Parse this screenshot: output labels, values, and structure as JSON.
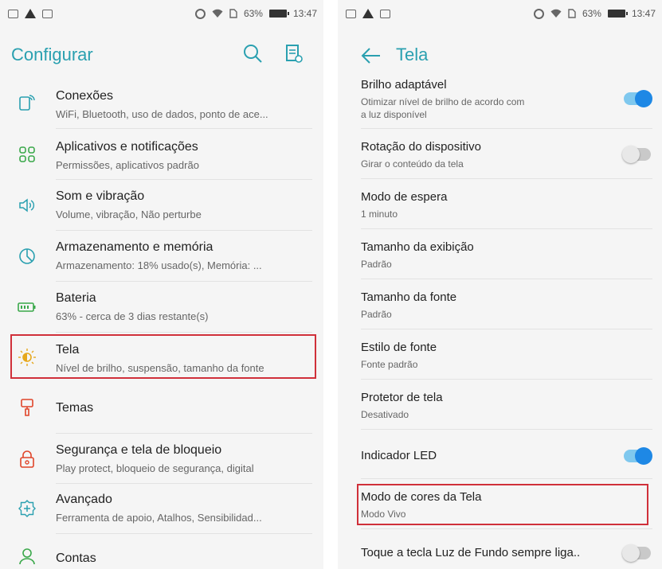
{
  "status_bar": {
    "battery": "63%",
    "time": "13:47"
  },
  "settings": {
    "title": "Configurar",
    "items": [
      {
        "icon": "connections-icon",
        "title": "Conexões",
        "subtitle": "WiFi, Bluetooth, uso de dados, ponto de ace..."
      },
      {
        "icon": "apps-icon",
        "title": "Aplicativos e notificações",
        "subtitle": "Permissões, aplicativos padrão"
      },
      {
        "icon": "volume-icon",
        "title": "Som e vibração",
        "subtitle": "Volume, vibração, Não perturbe"
      },
      {
        "icon": "storage-icon",
        "title": "Armazenamento e memória",
        "subtitle": "Armazenamento: 18% usado(s), Memória: ..."
      },
      {
        "icon": "battery-icon",
        "title": "Bateria",
        "subtitle": "63% - cerca de 3 dias restante(s)"
      },
      {
        "icon": "display-icon",
        "title": "Tela",
        "subtitle": "Nível de brilho, suspensão, tamanho da fonte"
      },
      {
        "icon": "themes-icon",
        "title": "Temas",
        "subtitle": ""
      },
      {
        "icon": "lock-icon",
        "title": "Segurança e tela de bloqueio",
        "subtitle": "Play protect, bloqueio de segurança, digital"
      },
      {
        "icon": "advanced-icon",
        "title": "Avançado",
        "subtitle": "Ferramenta de apoio, Atalhos, Sensibilidad..."
      },
      {
        "icon": "account-icon",
        "title": "Contas",
        "subtitle": ""
      }
    ]
  },
  "display": {
    "title": "Tela",
    "items": [
      {
        "title": "Brilho adaptável",
        "subtitle_lines": [
          "Otimizar nível de brilho de acordo com",
          "a luz disponível"
        ],
        "toggle": true
      },
      {
        "title": "Rotação do dispositivo",
        "subtitle_lines": [
          "Girar o conteúdo da tela"
        ],
        "toggle": false
      },
      {
        "title": "Modo de espera",
        "subtitle_lines": [
          "1 minuto"
        ]
      },
      {
        "title": "Tamanho da exibição",
        "subtitle_lines": [
          "Padrão"
        ]
      },
      {
        "title": "Tamanho da fonte",
        "subtitle_lines": [
          "Padrão"
        ]
      },
      {
        "title": "Estilo de fonte",
        "subtitle_lines": [
          "Fonte padrão"
        ]
      },
      {
        "title": "Protetor de tela",
        "subtitle_lines": [
          "Desativado"
        ]
      },
      {
        "title": "Indicador LED",
        "subtitle_lines": [],
        "toggle": true
      },
      {
        "title": "Modo de cores da Tela",
        "subtitle_lines": [
          "Modo Vivo"
        ]
      },
      {
        "title": "Toque a tecla Luz de Fundo sempre liga..",
        "subtitle_lines": [],
        "toggle": false
      }
    ]
  },
  "colors": {
    "accent": "#2aa0b0",
    "highlight": "#d0303a",
    "toggle_on": "#1e88e5"
  }
}
